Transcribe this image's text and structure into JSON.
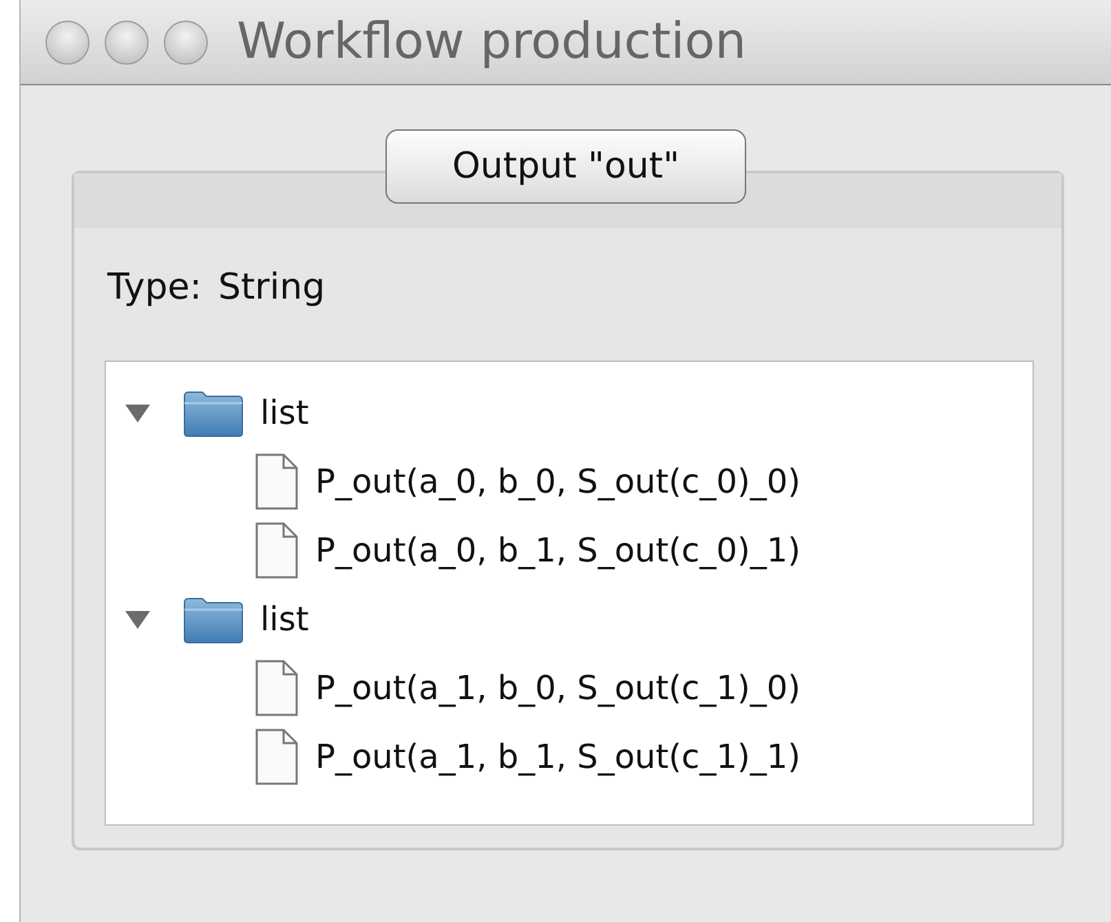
{
  "window": {
    "title": "Workflow production"
  },
  "group": {
    "title": "Output \"out\"",
    "type_label": "Type:",
    "type_value": "String"
  },
  "tree": [
    {
      "kind": "folder",
      "label": "list",
      "expanded": true,
      "children": [
        {
          "kind": "file",
          "label": "P_out(a_0, b_0, S_out(c_0)_0)"
        },
        {
          "kind": "file",
          "label": "P_out(a_0, b_1, S_out(c_0)_1)"
        }
      ]
    },
    {
      "kind": "folder",
      "label": "list",
      "expanded": true,
      "children": [
        {
          "kind": "file",
          "label": "P_out(a_1, b_0, S_out(c_1)_0)"
        },
        {
          "kind": "file",
          "label": "P_out(a_1, b_1, S_out(c_1)_1)"
        }
      ]
    }
  ]
}
